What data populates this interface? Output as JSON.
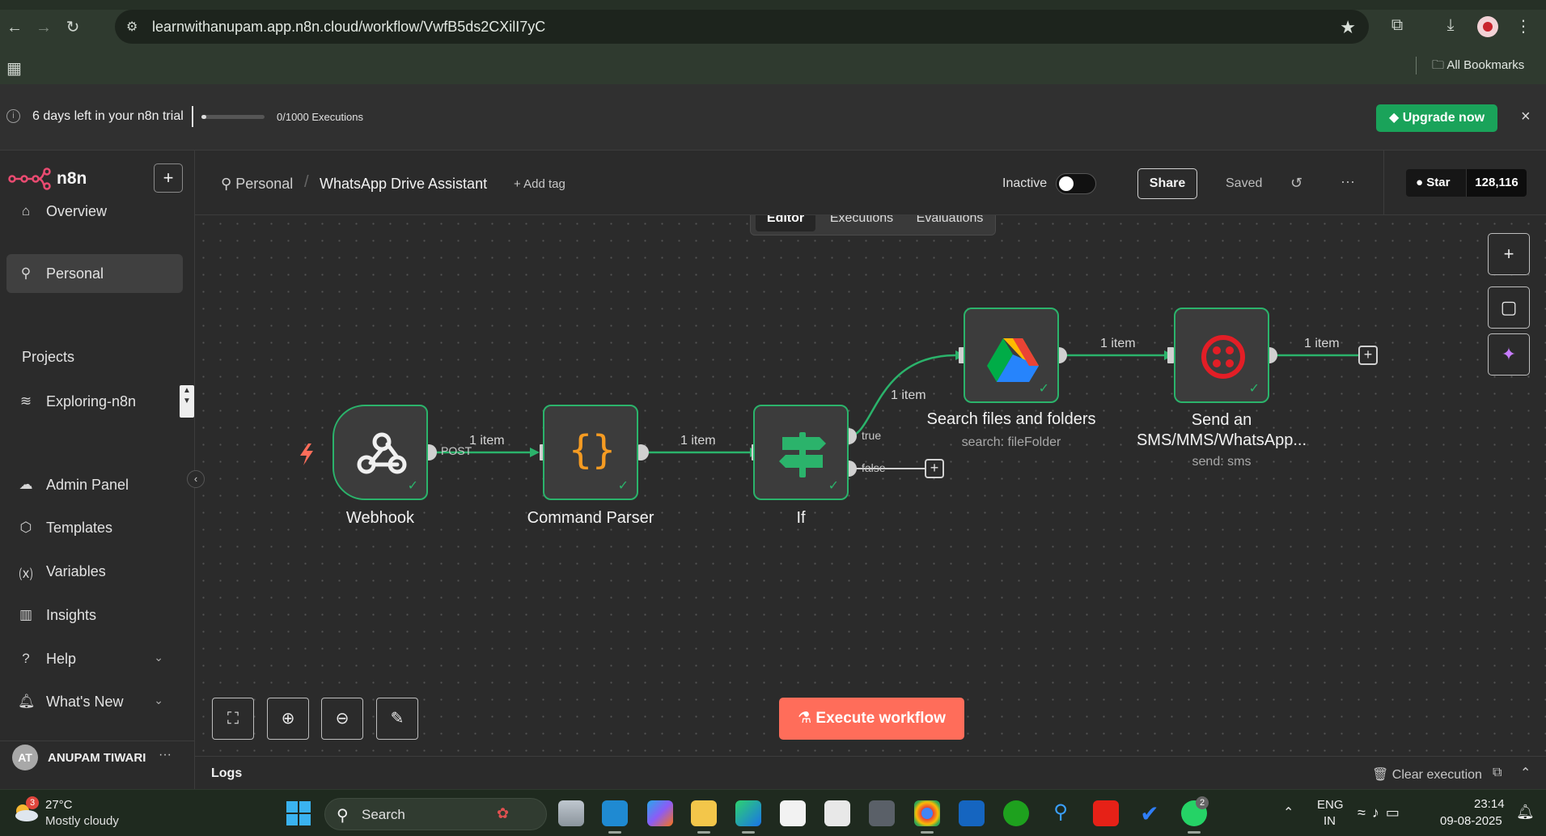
{
  "browser": {
    "url": "learnwithanupam.app.n8n.cloud/workflow/VwfB5ds2CXilI7yC",
    "all_bookmarks": "All Bookmarks"
  },
  "trial": {
    "text": "6 days left in your n8n trial",
    "executions": "0/1000 Executions",
    "progress": 0.02,
    "upgrade_label": "Upgrade now"
  },
  "sidebar": {
    "logo": "n8n",
    "items": [
      {
        "label": "Overview",
        "icon": "home-icon"
      },
      {
        "label": "Personal",
        "icon": "user-icon"
      }
    ],
    "projects_label": "Projects",
    "projects": [
      {
        "label": "Exploring-n8n",
        "icon": "layers-icon"
      }
    ],
    "bottom_items": [
      {
        "label": "Admin Panel",
        "icon": "cloud-icon"
      },
      {
        "label": "Templates",
        "icon": "box-icon"
      },
      {
        "label": "Variables",
        "icon": "variable-icon"
      },
      {
        "label": "Insights",
        "icon": "chart-icon"
      },
      {
        "label": "Help",
        "icon": "help-icon"
      },
      {
        "label": "What's New",
        "icon": "bell-icon"
      }
    ],
    "user": {
      "initials": "AT",
      "name": "ANUPAM TIWARI"
    }
  },
  "header": {
    "breadcrumb_project": "Personal",
    "workflow_name": "WhatsApp Drive Assistant",
    "add_tag": "+ Add tag",
    "status": "Inactive",
    "share_label": "Share",
    "saved_label": "Saved",
    "github_star": "Star",
    "github_count": "128,116"
  },
  "view_tabs": [
    "Editor",
    "Executions",
    "Evaluations"
  ],
  "workflow": {
    "nodes": [
      {
        "title": "Webhook",
        "subtitle": "",
        "icon": "webhook-icon"
      },
      {
        "title": "Command Parser",
        "subtitle": "",
        "icon": "code-braces-icon"
      },
      {
        "title": "If",
        "subtitle": "",
        "icon": "signpost-icon"
      },
      {
        "title": "Search files and folders",
        "subtitle": "search: fileFolder",
        "icon": "google-drive-icon"
      },
      {
        "title": "Send an SMS/MMS/WhatsApp...",
        "subtitle": "send: sms",
        "icon": "twilio-icon"
      }
    ],
    "edges": {
      "webhook_port": "POST",
      "webhook_to_parser": "1 item",
      "parser_to_if": "1 item",
      "if_true": "true",
      "if_false": "false",
      "if_to_drive": "1 item",
      "drive_to_twilio": "1 item",
      "twilio_out": "1 item"
    },
    "execute_label": "Execute workflow"
  },
  "logs": {
    "label": "Logs",
    "clear_label": "Clear execution"
  },
  "taskbar": {
    "weather_temp": "27°C",
    "weather_desc": "Mostly cloudy",
    "weather_badge": "3",
    "search_placeholder": "Search",
    "whatsapp_badge": "2",
    "lang": "ENG",
    "region": "IN",
    "time": "23:14",
    "date": "09-08-2025"
  }
}
